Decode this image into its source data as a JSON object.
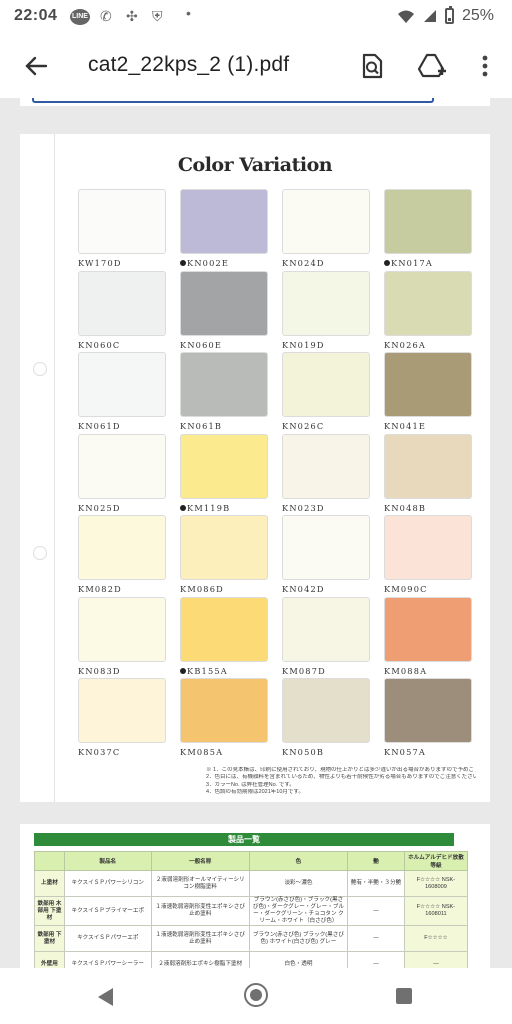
{
  "status_bar": {
    "time": "22:04",
    "battery": "25%",
    "line_label": "LINE"
  },
  "app_bar": {
    "title": "cat2_22kps_2 (1).pdf"
  },
  "page1": {
    "title": "Color Variation",
    "swatches": [
      {
        "code": "KW170D",
        "marked": false,
        "color": "#fbfbfa"
      },
      {
        "code": "KN002E",
        "marked": true,
        "color": "#bdbad7"
      },
      {
        "code": "KN024D",
        "marked": false,
        "color": "#fbfbf3"
      },
      {
        "code": "KN017A",
        "marked": true,
        "color": "#c6cba0"
      },
      {
        "code": "KN060C",
        "marked": false,
        "color": "#eef1ef"
      },
      {
        "code": "KN060E",
        "marked": false,
        "color": "#a3a4a5"
      },
      {
        "code": "KN019D",
        "marked": false,
        "color": "#f4f6e6"
      },
      {
        "code": "KN026A",
        "marked": false,
        "color": "#d9dcb2"
      },
      {
        "code": "KN061D",
        "marked": false,
        "color": "#f5f6f6"
      },
      {
        "code": "KN061B",
        "marked": false,
        "color": "#b8bbb8"
      },
      {
        "code": "KN026C",
        "marked": false,
        "color": "#f2f3d9"
      },
      {
        "code": "KN041E",
        "marked": false,
        "color": "#a99b76"
      },
      {
        "code": "KN025D",
        "marked": false,
        "color": "#fbfbf4"
      },
      {
        "code": "KM119B",
        "marked": true,
        "color": "#fbea8e"
      },
      {
        "code": "KN023D",
        "marked": false,
        "color": "#f8f5e8"
      },
      {
        "code": "KN048B",
        "marked": false,
        "color": "#e8d9bc"
      },
      {
        "code": "KM082D",
        "marked": false,
        "color": "#fcf9dc"
      },
      {
        "code": "KM086D",
        "marked": false,
        "color": "#fcefbc"
      },
      {
        "code": "KN042D",
        "marked": false,
        "color": "#fbfaf3"
      },
      {
        "code": "KM090C",
        "marked": false,
        "color": "#fbe3d7"
      },
      {
        "code": "KN083D",
        "marked": false,
        "color": "#fcfae4"
      },
      {
        "code": "KB155A",
        "marked": true,
        "color": "#fcdb76"
      },
      {
        "code": "KM087D",
        "marked": false,
        "color": "#f7f5e4"
      },
      {
        "code": "KM088A",
        "marked": false,
        "color": "#ef9d72"
      },
      {
        "code": "KN037C",
        "marked": false,
        "color": "#fdf4d9"
      },
      {
        "code": "KM085A",
        "marked": false,
        "color": "#f4c56e"
      },
      {
        "code": "KN050B",
        "marked": false,
        "color": "#e3dfcb"
      },
      {
        "code": "KN057A",
        "marked": false,
        "color": "#9d8e7c"
      }
    ],
    "notes": [
      "※ 1．この見本帳は、印刷に使用されており、現物の仕上がりとは多少違いが出る場合がありますので予めご了承ください。",
      "2．色目には、有機顔料を含まれているため、物性よりも若干耐候性が劣る場合もありますのでご注意ください。",
      "3．カラーNo. は弊社管理No. です。",
      "4．色調の有効期限は2021年10月です。"
    ]
  },
  "page2": {
    "table_title": "製品一覧",
    "headers": [
      "",
      "製品名",
      "一般名称",
      "色",
      "艶",
      "ホルムアルデヒド放散等級"
    ],
    "rows": [
      [
        "上塗材",
        "キクスイＳＰパワーシリコン",
        "２液弱溶剤形オールマイティーシリコン樹脂塗料",
        "淡彩～濃色",
        "艶有・半艶・３分艶",
        "F☆☆☆☆ NSK-1608009"
      ],
      [
        "鉄部用 木部用 下塗材",
        "キクスイＳＰプライマーエポ",
        "１液速乾弱溶剤形変性エポキシさび止め塗料",
        "ブラウン(赤さび色)・ブラック(黒さび色)・ダークグレー・グレー・ブルー・ダークグリーン・チョコタン クリーム・ホワイト（白さび色）",
        "—",
        "F☆☆☆☆ NSK-1608011"
      ],
      [
        "鉄部用 下塗材",
        "キクスイＳＰパワーエポ",
        "１液速乾弱溶剤形変性エポキシさび止め塗料",
        "ブラウン(赤さび色) ブラック(黒さび色) ホワイト(白さび色) グレー",
        "—",
        "F☆☆☆☆"
      ],
      [
        "外壁用",
        "キクスイＳＰパワーシーラー",
        "２液弱溶剤形エポキシ樹脂下塗材",
        "白色・透明",
        "—",
        "—"
      ]
    ]
  }
}
